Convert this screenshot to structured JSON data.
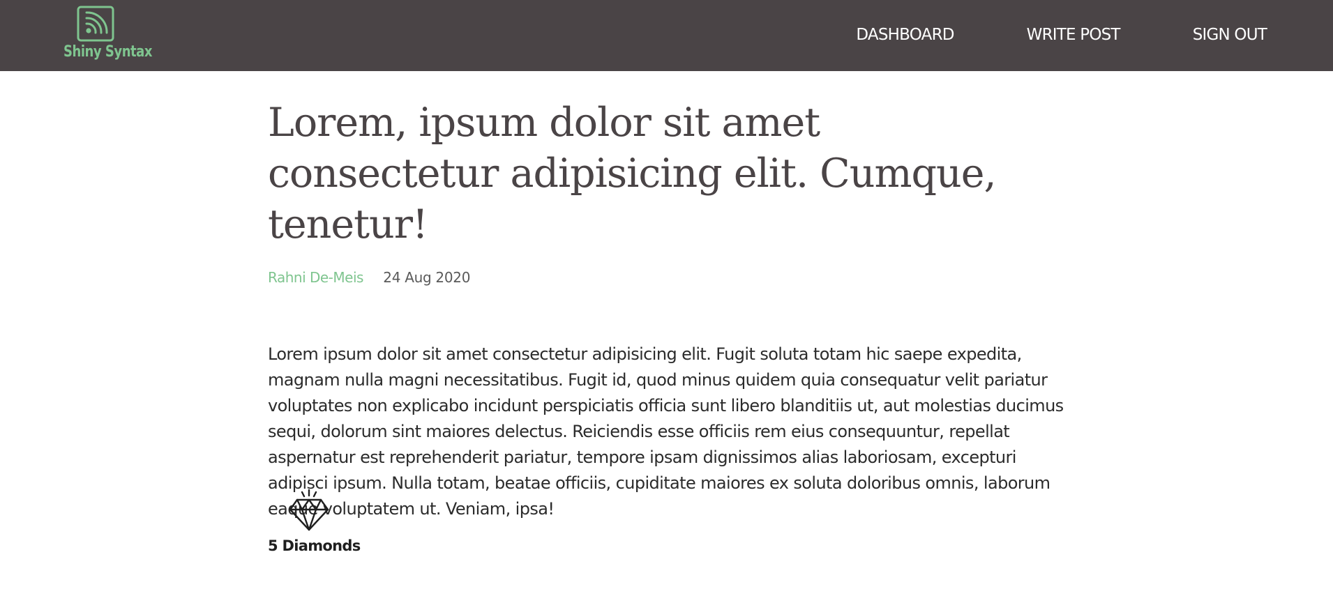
{
  "header": {
    "brand_name": "Shiny Syntax",
    "brand_icon": "rss-feed-icon",
    "nav": {
      "dashboard": "DASHBOARD",
      "write_post": "WRITE POST",
      "sign_out": "SIGN OUT"
    }
  },
  "post": {
    "title": "Lorem, ipsum dolor sit amet consectetur adipisicing elit. Cumque, tenetur!",
    "author": "Rahni De-Meis",
    "date": "24 Aug 2020",
    "body": "Lorem ipsum dolor sit amet consectetur adipisicing elit. Fugit soluta totam hic saepe expedita, magnam nulla magni necessitatibus. Fugit id, quod minus quidem quia consequatur velit pariatur voluptates non explicabo incidunt perspiciatis officia sunt libero blanditiis ut, aut molestias ducimus sequi, dolorum sint maiores delectus. Reiciendis esse officiis rem eius consequuntur, repellat aspernatur est reprehenderit pariatur, tempore ipsam dignissimos alias laboriosam, excepturi adipisci ipsum. Nulla totam, beatae officiis, cupiditate maiores ex soluta doloribus omnis, laborum eaque voluptatem ut. Veniam, ipsa!",
    "reward": {
      "icon": "diamond-icon",
      "label": "5 Diamonds"
    }
  },
  "colors": {
    "header_bg": "#4a4446",
    "accent": "#7fc58f",
    "title": "#4a4446",
    "body_text": "#2b2b2b"
  }
}
